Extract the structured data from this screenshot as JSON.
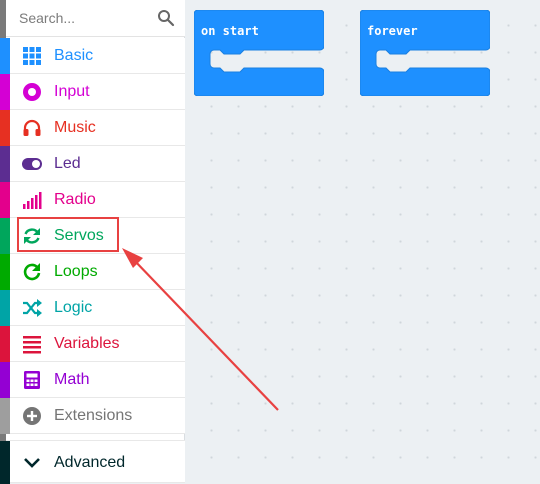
{
  "search": {
    "placeholder": "Search...",
    "icon": "search-icon"
  },
  "categories": [
    {
      "label": "Basic",
      "color": "#1e90ff",
      "icon": "grid-icon"
    },
    {
      "label": "Input",
      "color": "#d400d4",
      "icon": "target-icon"
    },
    {
      "label": "Music",
      "color": "#e63022",
      "icon": "headphones-icon"
    },
    {
      "label": "Led",
      "color": "#5c2d91",
      "icon": "toggle-icon"
    },
    {
      "label": "Radio",
      "color": "#e3008c",
      "icon": "signal-bars-icon"
    },
    {
      "label": "Servos",
      "color": "#00a65c",
      "icon": "refresh-icon"
    },
    {
      "label": "Loops",
      "color": "#00aa00",
      "icon": "loop-icon"
    },
    {
      "label": "Logic",
      "color": "#00a4a6",
      "icon": "shuffle-icon"
    },
    {
      "label": "Variables",
      "color": "#dc143c",
      "icon": "list-icon"
    },
    {
      "label": "Math",
      "color": "#9400d3",
      "icon": "calculator-icon"
    },
    {
      "label": "Extensions",
      "color": "#757575",
      "icon": "plus-circle-icon"
    },
    {
      "label": "Advanced",
      "color": "#00272b",
      "icon": "chevron-down-icon"
    }
  ],
  "blocks": {
    "on_start": "on start",
    "forever": "forever",
    "color": "#1e90ff"
  },
  "annotation": {
    "color": "#e84141"
  }
}
